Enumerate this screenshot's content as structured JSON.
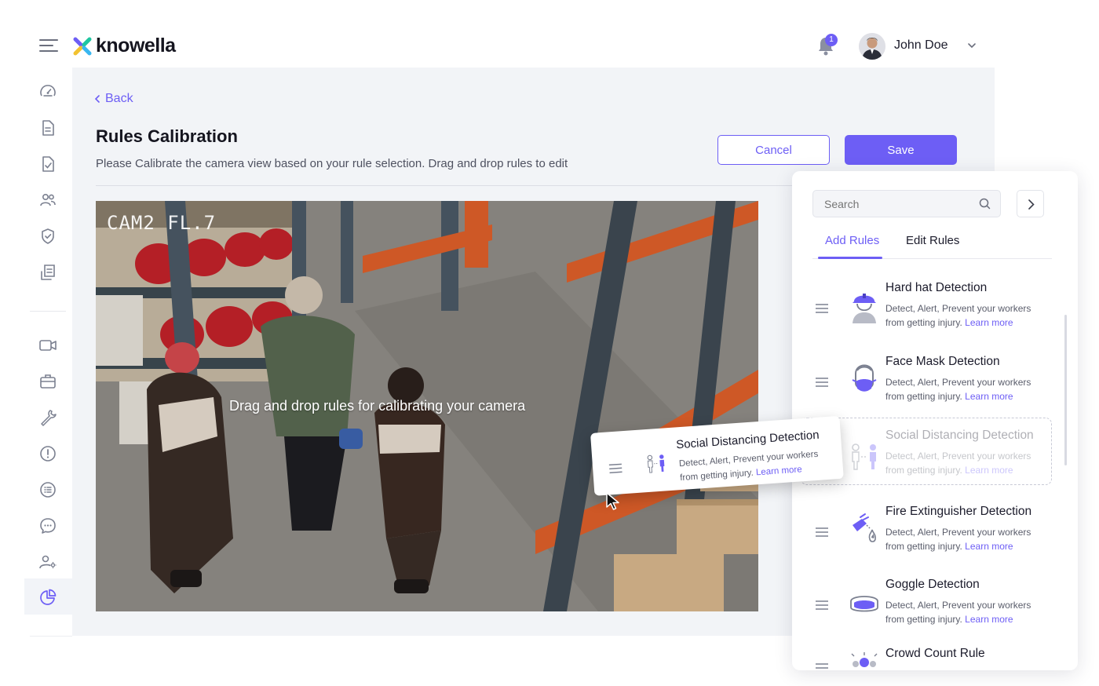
{
  "brand": {
    "name": "knowella",
    "accent": "#6d5ef5"
  },
  "header": {
    "notification_count": "1",
    "user_name": "John Doe"
  },
  "sidebar": {
    "items": [
      {
        "icon": "dashboard-gauge-icon"
      },
      {
        "icon": "document-icon"
      },
      {
        "icon": "document-check-icon"
      },
      {
        "icon": "users-icon"
      },
      {
        "icon": "shield-check-icon"
      },
      {
        "icon": "report-icon"
      },
      {
        "icon": "video-camera-icon"
      },
      {
        "icon": "briefcase-icon"
      },
      {
        "icon": "wrench-icon"
      },
      {
        "icon": "alert-circle-icon"
      },
      {
        "icon": "list-circle-icon"
      },
      {
        "icon": "chat-bubble-icon"
      },
      {
        "icon": "user-settings-icon"
      },
      {
        "icon": "pie-chart-icon",
        "active": true
      }
    ]
  },
  "page": {
    "back_label": "Back",
    "title": "Rules Calibration",
    "subtitle": "Please Calibrate the camera view based on your rule selection. Drag and drop rules to edit",
    "cancel_label": "Cancel",
    "save_label": "Save"
  },
  "camera": {
    "label": "CAM2 FL.7",
    "drop_hint": "Drag and drop rules for calibrating your camera"
  },
  "dragging_rule": {
    "title": "Social Distancing Detection",
    "desc_line1": "Detect, Alert, Prevent your workers",
    "desc_line2": "from getting injury.",
    "learn_more": "Learn more"
  },
  "rules_panel": {
    "search_placeholder": "Search",
    "tabs": [
      {
        "label": "Add Rules",
        "active": true
      },
      {
        "label": "Edit Rules"
      }
    ],
    "rules": [
      {
        "title": "Hard hat Detection",
        "desc_line1": "Detect, Alert, Prevent your workers",
        "desc_line2": "from getting injury.",
        "learn_more": "Learn more",
        "icon": "hard-hat-icon"
      },
      {
        "title": "Face Mask Detection",
        "desc_line1": "Detect, Alert, Prevent your workers",
        "desc_line2": "from getting injury.",
        "learn_more": "Learn more",
        "icon": "face-mask-icon"
      },
      {
        "title": "Social Distancing Detection",
        "desc_line1": "Detect, Alert, Prevent your workers",
        "desc_line2": "from getting injury.",
        "learn_more": "Learn more",
        "icon": "social-distancing-icon",
        "state": "placeholder"
      },
      {
        "title": "Fire Extinguisher Detection",
        "desc_line1": "Detect, Alert, Prevent your workers",
        "desc_line2": "from getting injury.",
        "learn_more": "Learn more",
        "icon": "fire-extinguisher-icon"
      },
      {
        "title": "Goggle Detection",
        "desc_line1": "Detect, Alert, Prevent your workers",
        "desc_line2": "from getting injury.",
        "learn_more": "Learn more",
        "icon": "goggle-icon"
      },
      {
        "title": "Crowd Count Rule",
        "icon": "crowd-count-icon"
      }
    ]
  }
}
